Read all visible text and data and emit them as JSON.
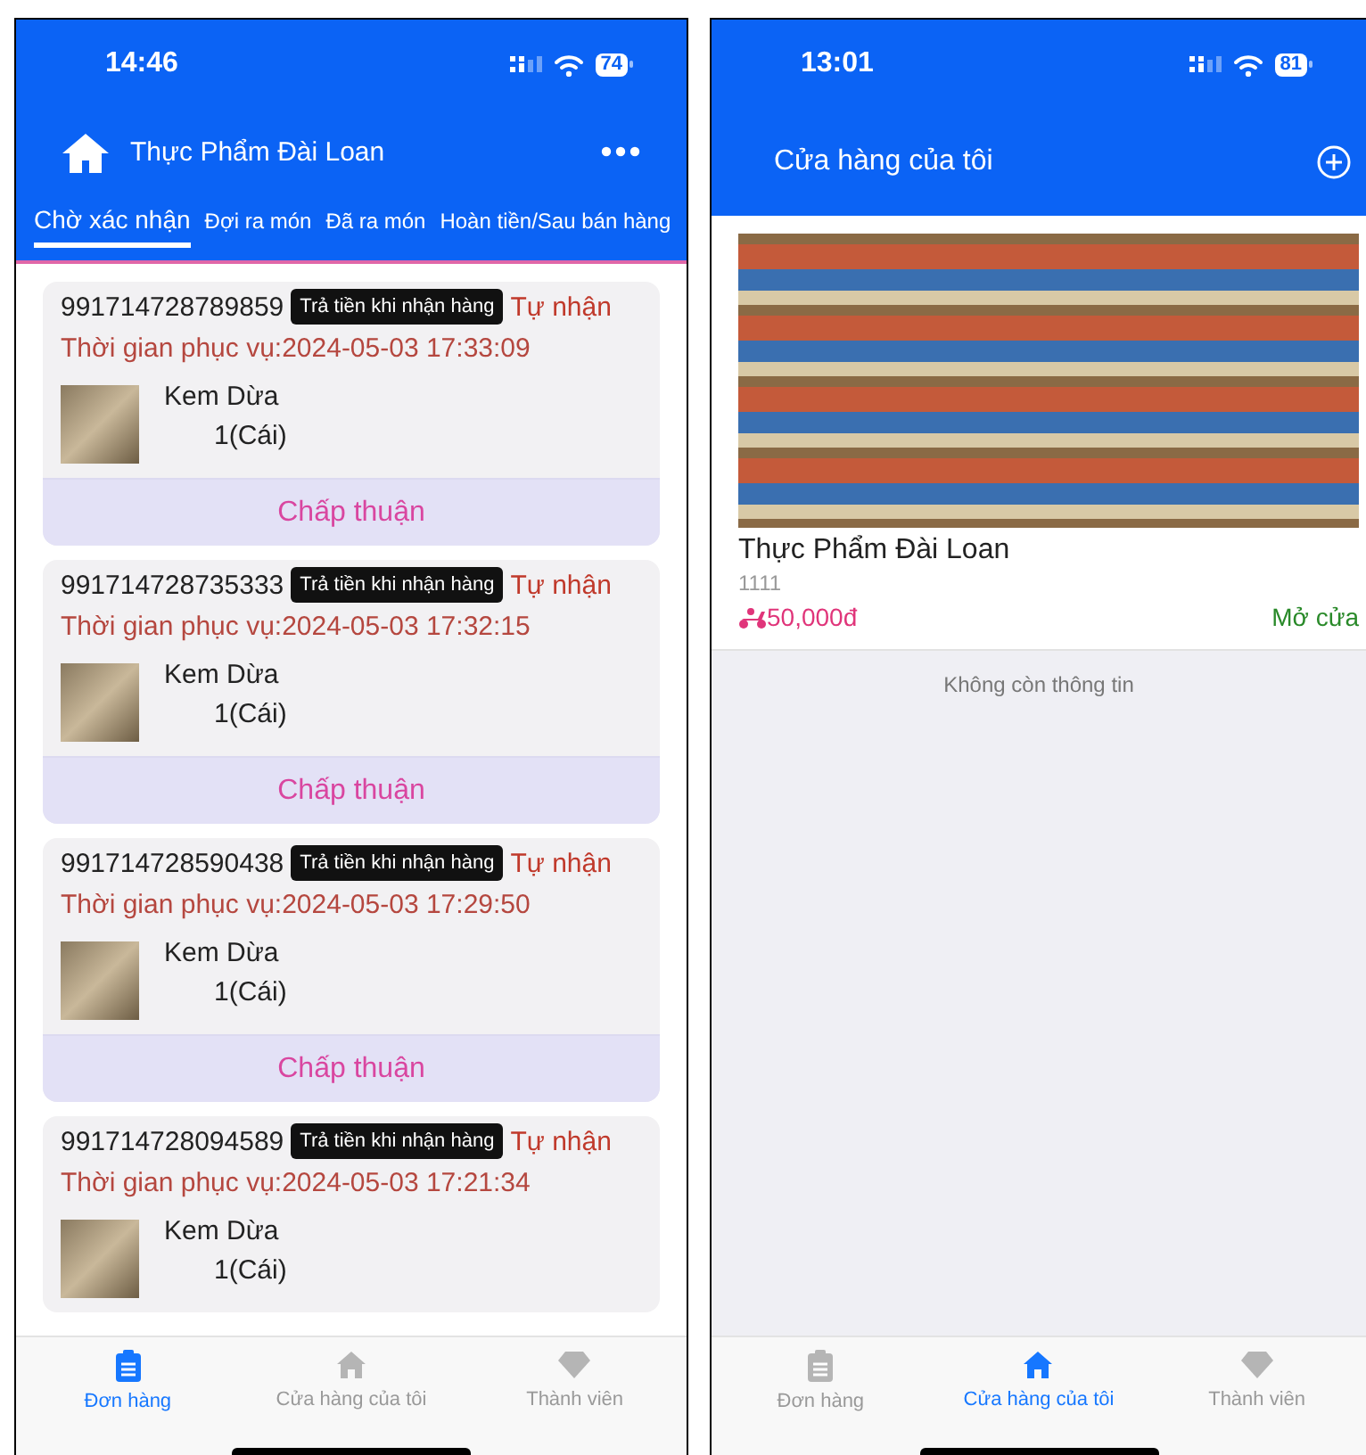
{
  "order_screen": {
    "status_bar": {
      "time": "14:46",
      "battery": "74"
    },
    "header": {
      "title": "Thực Phẩm Đài Loan"
    },
    "tabs": [
      {
        "label": "Chờ xác nhận",
        "selected": true
      },
      {
        "label": "Đợi ra món",
        "selected": false
      },
      {
        "label": "Đã ra món",
        "selected": false
      },
      {
        "label": "Hoàn tiền/Sau bán hàng",
        "selected": false
      }
    ],
    "orders": [
      {
        "number": "991714728789859",
        "payment": "Trả tiền khi nhận hàng",
        "delivery": "Tự nhận",
        "service_time": "Thời gian phục vụ:2024-05-03 17:33:09",
        "item": "Kem Dừa",
        "quantity": "1(Cái)",
        "action": "Chấp thuận"
      },
      {
        "number": "991714728735333",
        "payment": "Trả tiền khi nhận hàng",
        "delivery": "Tự nhận",
        "service_time": "Thời gian phục vụ:2024-05-03 17:32:15",
        "item": "Kem Dừa",
        "quantity": "1(Cái)",
        "action": "Chấp thuận"
      },
      {
        "number": "991714728590438",
        "payment": "Trả tiền khi nhận hàng",
        "delivery": "Tự nhận",
        "service_time": "Thời gian phục vụ:2024-05-03 17:29:50",
        "item": "Kem Dừa",
        "quantity": "1(Cái)",
        "action": "Chấp thuận"
      },
      {
        "number": "991714728094589",
        "payment": "Trả tiền khi nhận hàng",
        "delivery": "Tự nhận",
        "service_time": "Thời gian phục vụ:2024-05-03 17:21:34",
        "item": "Kem Dừa",
        "quantity": "1(Cái)"
      }
    ],
    "bottom_nav": [
      {
        "label": "Đơn hàng",
        "kind": "clipboard",
        "selected": true
      },
      {
        "label": "Cửa hàng của tôi",
        "kind": "home",
        "selected": false
      },
      {
        "label": "Thành viên",
        "kind": "diamond",
        "selected": false
      }
    ]
  },
  "store_screen": {
    "status_bar": {
      "time": "13:01",
      "battery": "81"
    },
    "header": {
      "title": "Cửa hàng của tôi"
    },
    "store": {
      "name": "Thực Phẩm Đài Loan",
      "code": "1111",
      "price": "50,000đ",
      "status": "Mở cửa"
    },
    "end_note": "Không còn thông tin",
    "bottom_nav": [
      {
        "label": "Đơn hàng",
        "kind": "clipboard",
        "selected": false
      },
      {
        "label": "Cửa hàng của tôi",
        "kind": "home",
        "selected": true
      },
      {
        "label": "Thành viên",
        "kind": "diamond",
        "selected": false
      }
    ]
  }
}
